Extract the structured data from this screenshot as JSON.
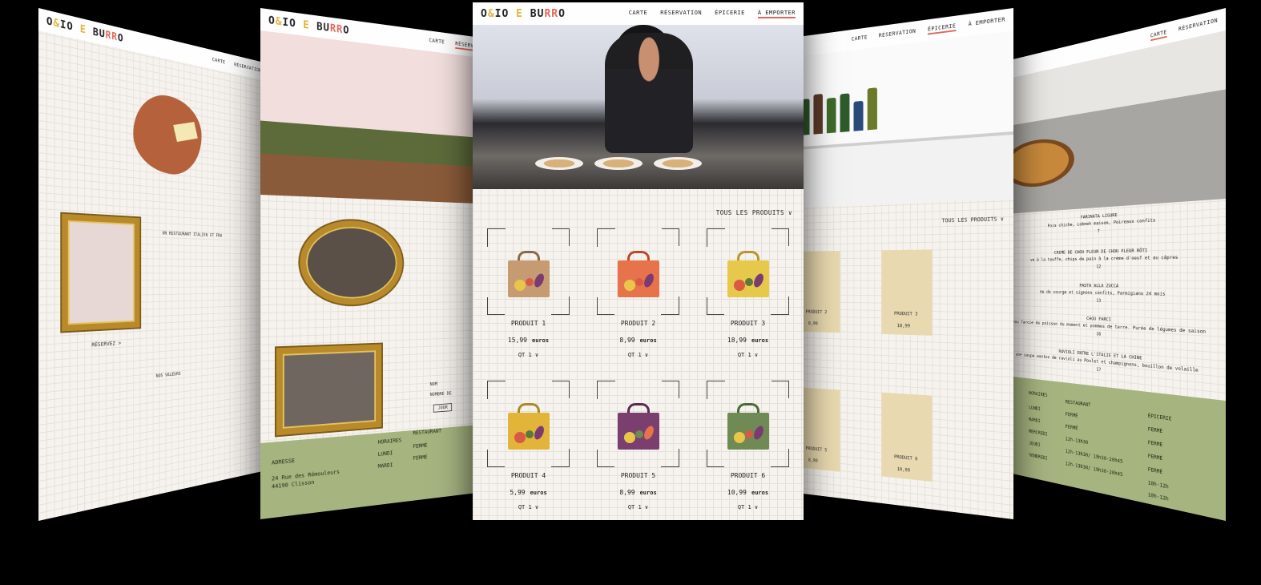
{
  "logo": {
    "part1": "O",
    "part2": "&",
    "part3": "IO ",
    "part4": "E",
    "part5": " BU",
    "part6": "RR",
    "part7": "O"
  },
  "nav": {
    "carte": "CARTE",
    "reservation": "RÉSERVATION",
    "epicerie": "ÉPICERIE",
    "emporter": "À EMPORTER"
  },
  "filter": "TOUS LES PRODUITS ∨",
  "currency": "euros",
  "products": [
    {
      "name": "PRODUIT 1",
      "price": "15,99",
      "qty": "QT 1 ∨",
      "color": "#c79b72"
    },
    {
      "name": "PRODUIT 2",
      "price": "8,99",
      "qty": "QT 1 ∨",
      "color": "#e6734b"
    },
    {
      "name": "PRODUIT 3",
      "price": "18,99",
      "qty": "QT 1 ∨",
      "color": "#e6c84a"
    },
    {
      "name": "PRODUIT 4",
      "price": "5,99",
      "qty": "QT 1 ∨",
      "color": "#e2b43a"
    },
    {
      "name": "PRODUIT 5",
      "price": "8,99",
      "qty": "QT 1 ∨",
      "color": "#7a3f6f"
    },
    {
      "name": "PRODUIT 6",
      "price": "10,99",
      "qty": "QT 1 ∨",
      "color": "#6f8a55"
    }
  ],
  "page1": {
    "heading": "UN RESTAURANT ITALIEN ET FRA",
    "cta": "RÉSERVEZ >",
    "values": "NOS VALEURS"
  },
  "page2": {
    "address_label": "ADRESSE",
    "address": "24 Rue des Rémouleurs",
    "city": "44190 Clisson",
    "horaires": "HORAIRES",
    "restaurant": "RESTAURANT",
    "lundi": "LUNDI",
    "mardi": "MARDI",
    "ferme": "FERMÉ",
    "nom": "NOM",
    "nombre": "NOMBRE DE",
    "jour": "JOUR"
  },
  "page4": {
    "filter": "TOUS LES PRODUITS ∨",
    "p2": "PRODUIT 2",
    "p2price": "8,99",
    "p3": "PRODUIT 3",
    "p3price": "18,99",
    "p5": "PRODUIT 5",
    "p5price": "8,99",
    "p6": "PRODUIT 6",
    "p6price": "10,99"
  },
  "page5": {
    "items": [
      {
        "title": "FARINATA LIGURE",
        "desc": "Pois chiche, Lobneh maison, Poireaux confits",
        "price": "7"
      },
      {
        "title": "CREME DE CHOU FLEUR DE CHOU FLEUR RÔTI",
        "desc": "ve à la teuffe, chips de pain à la crème d'oeuf et au câpres",
        "price": "12"
      },
      {
        "title": "PASTA ALLA ZUCCA",
        "desc": "me de courge et oignons confits, Parmigiano 24 mois",
        "price": "13"
      },
      {
        "title": "CHOU FARCI",
        "desc": "chou farcie de poisson du moment et pommes de terre. Purée de légumes de saison",
        "price": "16"
      },
      {
        "title": "RAVIOLI ENTRE L'ITALIE ET LA CHINE",
        "desc": "une soupe wonton de ravioli au Poulet et champignons, bouillon de volaille",
        "price": "17"
      }
    ],
    "horaires": "HORAIRES",
    "restaurant": "RESTAURANT",
    "epicerie": "ÉPICERIE",
    "days": [
      "LUNDI",
      "MARDI",
      "MERCREDI",
      "JEUDI",
      "VENDREDI"
    ],
    "resto_hours": [
      "FERMÉ",
      "FERMÉ",
      "12h-13h30",
      "12h-13h30/ 19h30-20h45",
      "12h-13h30/ 19h30-20h45"
    ],
    "epi_hours": [
      "FERMÉ",
      "FERMÉ",
      "FERMÉ",
      "FERMÉ",
      "10h-12h"
    ],
    "extra_epi": "10h-12h"
  }
}
